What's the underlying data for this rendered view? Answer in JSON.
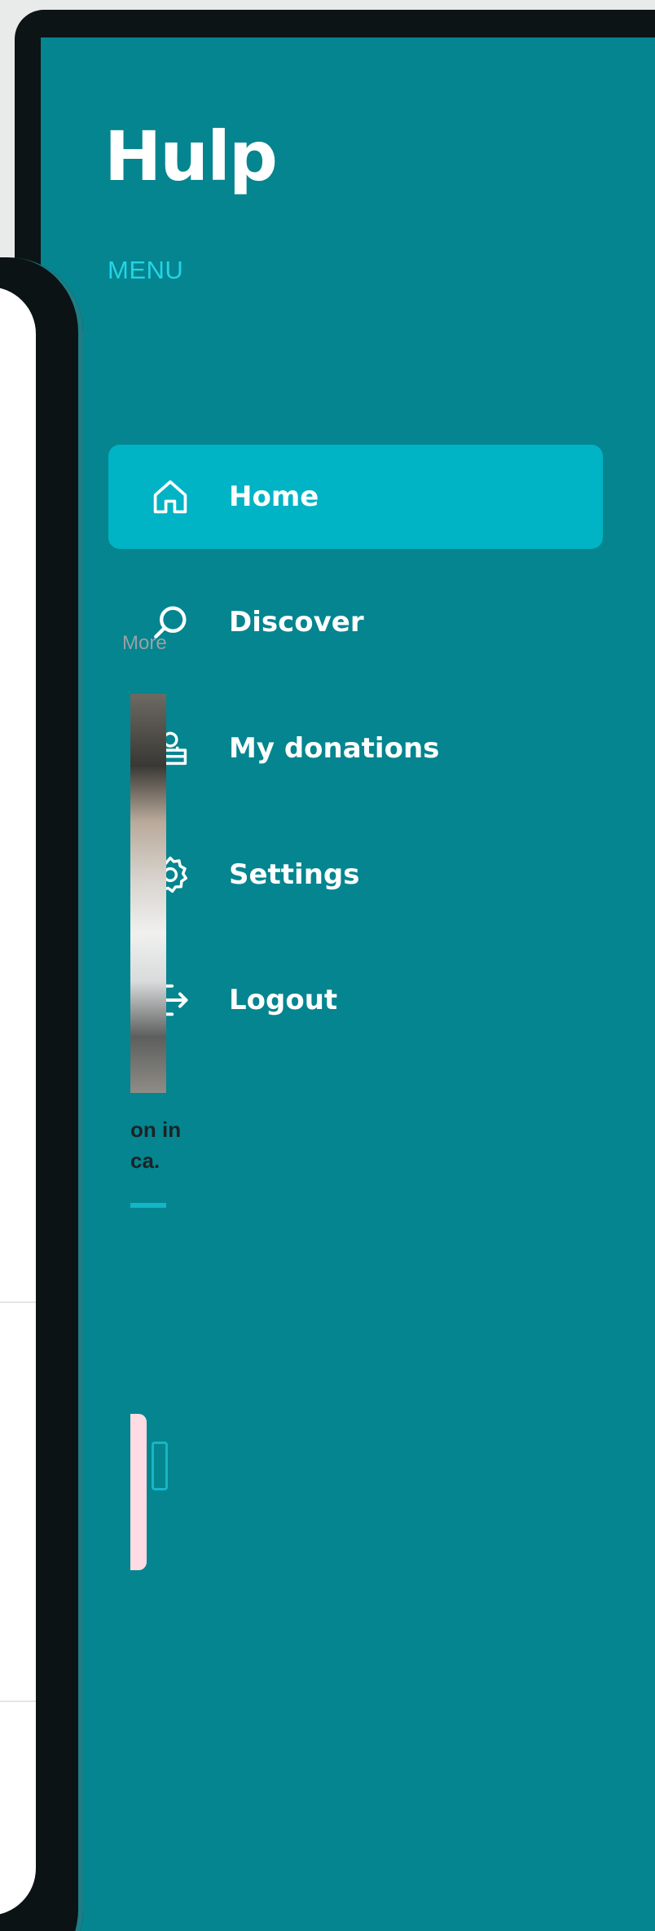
{
  "app": {
    "logo_text": "Hulp",
    "menu_heading": "MENU"
  },
  "colors": {
    "panel_bg": "#04858f",
    "active_item_bg": "#00b3c5",
    "menu_heading": "#25d3e6",
    "frame": "#0c1416"
  },
  "nav": {
    "items": [
      {
        "label": "Home",
        "icon": "home-icon",
        "active": true
      },
      {
        "label": "Discover",
        "icon": "search-icon",
        "active": false
      },
      {
        "label": "My donations",
        "icon": "donation-box-icon",
        "active": false
      },
      {
        "label": "Settings",
        "icon": "gear-icon",
        "active": false
      },
      {
        "label": "Logout",
        "icon": "logout-icon",
        "active": false
      }
    ]
  },
  "background_phone": {
    "more_link": "More",
    "card_caption": "on in\nca."
  }
}
